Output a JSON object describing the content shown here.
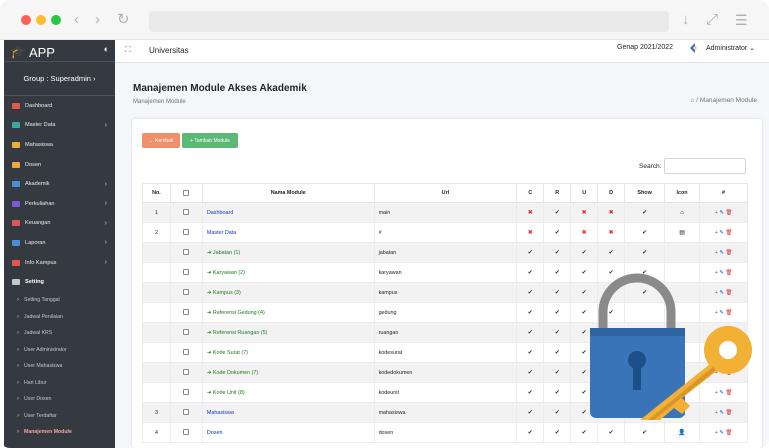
{
  "sidebar": {
    "brand": "APP",
    "group": "Group : Superadmin  ›",
    "items": [
      {
        "label": "Dashboard",
        "icon": "dashboard-icon",
        "color": "#e2574c",
        "chevron": false
      },
      {
        "label": "Master Data",
        "icon": "database-icon",
        "color": "#3aa6a0",
        "chevron": true
      },
      {
        "label": "Mahasiswa",
        "icon": "users-icon",
        "color": "#f0a840",
        "chevron": false
      },
      {
        "label": "Dosen",
        "icon": "user-icon",
        "color": "#f0a840",
        "chevron": false
      },
      {
        "label": "Akademik",
        "icon": "book-icon",
        "color": "#4a90d9",
        "chevron": true
      },
      {
        "label": "Perkuliahan",
        "icon": "class-icon",
        "color": "#7b5cd6",
        "chevron": true
      },
      {
        "label": "Keuangan",
        "icon": "money-icon",
        "color": "#e2574c",
        "chevron": true
      },
      {
        "label": "Laporan",
        "icon": "report-icon",
        "color": "#4a90d9",
        "chevron": true
      },
      {
        "label": "Info Kampus",
        "icon": "info-icon",
        "color": "#e2574c",
        "chevron": true
      },
      {
        "label": "Setting",
        "icon": "code-icon",
        "color": "#c2c7d0",
        "chevron": false
      }
    ],
    "submenu": [
      "Setting Tanggal",
      "Jadwal Penilaian",
      "Jadwal KRS",
      "User Administrator",
      "User Mahasiswa",
      "Hari Libur",
      "User Dosen",
      "User Terdaftar",
      "Manajemen Module"
    ]
  },
  "topbar": {
    "app": "Universitas",
    "semester": "Genap 2021/2022",
    "user": "Administrator  ⌄"
  },
  "page": {
    "title": "Manajemen Module Akses Akademik",
    "subtitle": "Manajemen Module",
    "breadcrumb": "⌂  /  Manajemen Module"
  },
  "buttons": {
    "back": "← Kembali",
    "add": "+ Tambah Module"
  },
  "search": {
    "label": "Search:",
    "placeholder": ""
  },
  "table": {
    "headers": [
      "No.",
      "",
      "Nama Module",
      "Url",
      "C",
      "R",
      "U",
      "D",
      "Show",
      "Icon",
      "#"
    ],
    "rows": [
      {
        "no": "1",
        "name": "Dashboard",
        "url": "main",
        "c": "x",
        "r": "v",
        "u": "x",
        "d": "x",
        "show": "v",
        "icon": "home",
        "sub": false
      },
      {
        "no": "2",
        "name": "Master Data",
        "url": "#",
        "c": "x",
        "r": "v",
        "u": "x",
        "d": "x",
        "show": "v",
        "icon": "db",
        "sub": false
      },
      {
        "no": "",
        "name": "Jabatan (1)",
        "url": "jabatan",
        "c": "v",
        "r": "v",
        "u": "v",
        "d": "v",
        "show": "v",
        "icon": "",
        "sub": true
      },
      {
        "no": "",
        "name": "Karyawan (2)",
        "url": "karyawan",
        "c": "v",
        "r": "v",
        "u": "v",
        "d": "v",
        "show": "v",
        "icon": "",
        "sub": true
      },
      {
        "no": "",
        "name": "Kampus (3)",
        "url": "kampus",
        "c": "v",
        "r": "v",
        "u": "v",
        "d": "v",
        "show": "v",
        "icon": "",
        "sub": true
      },
      {
        "no": "",
        "name": "Referensi Gedung (4)",
        "url": "gedung",
        "c": "v",
        "r": "v",
        "u": "v",
        "d": "v",
        "show": "",
        "icon": "",
        "sub": true
      },
      {
        "no": "",
        "name": "Referensi Ruangan (5)",
        "url": "ruangan",
        "c": "v",
        "r": "v",
        "u": "v",
        "d": "v",
        "show": "",
        "icon": "",
        "sub": true
      },
      {
        "no": "",
        "name": "Kode Surat (7)",
        "url": "kodesurat",
        "c": "v",
        "r": "v",
        "u": "v",
        "d": "",
        "show": "",
        "icon": "",
        "sub": true
      },
      {
        "no": "",
        "name": "Kode Dokumen (7)",
        "url": "kodedokumen",
        "c": "v",
        "r": "v",
        "u": "v",
        "d": "",
        "show": "",
        "icon": "",
        "sub": true
      },
      {
        "no": "",
        "name": "Kode Unit (8)",
        "url": "kodeunit",
        "c": "v",
        "r": "v",
        "u": "v",
        "d": "",
        "show": "",
        "icon": "",
        "sub": true
      },
      {
        "no": "3",
        "name": "Mahasiswa",
        "url": "mahasiswa",
        "c": "v",
        "r": "v",
        "u": "v",
        "d": "",
        "show": "",
        "icon": "users",
        "sub": false
      },
      {
        "no": "4",
        "name": "Dosen",
        "url": "dosen",
        "c": "v",
        "r": "v",
        "u": "v",
        "d": "v",
        "show": "v",
        "icon": "user",
        "sub": false
      }
    ]
  },
  "colors": {
    "sidebar": "#343a40",
    "content_bg": "#f4f6f9",
    "lock_body": "#3a74b8",
    "key": "#f2b134",
    "shackle": "#8a8a8a"
  }
}
